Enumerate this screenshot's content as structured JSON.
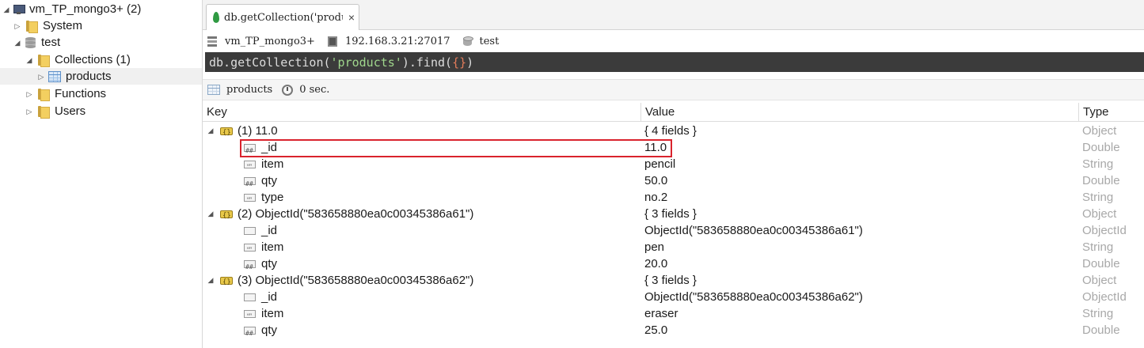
{
  "sidebar": {
    "connection": "vm_TP_mongo3+ (2)",
    "system": "System",
    "database": "test",
    "collections": "Collections (1)",
    "collection_item": "products",
    "functions": "Functions",
    "users": "Users"
  },
  "tab": {
    "title": "db.getCollection('produc…",
    "close": "×"
  },
  "info": {
    "connection": "vm_TP_mongo3+",
    "host": "192.168.3.21:27017",
    "database": "test"
  },
  "query": {
    "prefix": "db.getCollection(",
    "collection_arg": "'products'",
    "middle": ").find(",
    "arg": "{}",
    "suffix": ")"
  },
  "result_bar": {
    "collection": "products",
    "time": "0 sec."
  },
  "table": {
    "headers": {
      "key": "Key",
      "value": "Value",
      "type": "Type"
    },
    "rows": [
      {
        "key": "(1) 11.0",
        "value": "{ 4 fields }",
        "type": "Object"
      },
      {
        "key": "_id",
        "value": "11.0",
        "type": "Double"
      },
      {
        "key": "item",
        "value": "pencil",
        "type": "String"
      },
      {
        "key": "qty",
        "value": "50.0",
        "type": "Double"
      },
      {
        "key": "type",
        "value": "no.2",
        "type": "String"
      },
      {
        "key": "(2) ObjectId(\"583658880ea0c00345386a61\")",
        "value": "{ 3 fields }",
        "type": "Object"
      },
      {
        "key": "_id",
        "value": "ObjectId(\"583658880ea0c00345386a61\")",
        "type": "ObjectId"
      },
      {
        "key": "item",
        "value": "pen",
        "type": "String"
      },
      {
        "key": "qty",
        "value": "20.0",
        "type": "Double"
      },
      {
        "key": "(3) ObjectId(\"583658880ea0c00345386a62\")",
        "value": "{ 3 fields }",
        "type": "Object"
      },
      {
        "key": "_id",
        "value": "ObjectId(\"583658880ea0c00345386a62\")",
        "type": "ObjectId"
      },
      {
        "key": "item",
        "value": "eraser",
        "type": "String"
      },
      {
        "key": "qty",
        "value": "25.0",
        "type": "Double"
      }
    ]
  },
  "colors": {
    "highlight": "#d9232d",
    "editor_bg": "#3b3b3b",
    "string_literal": "#9fd68c",
    "brace": "#e07b5a",
    "type_text": "#a8a8a8"
  }
}
